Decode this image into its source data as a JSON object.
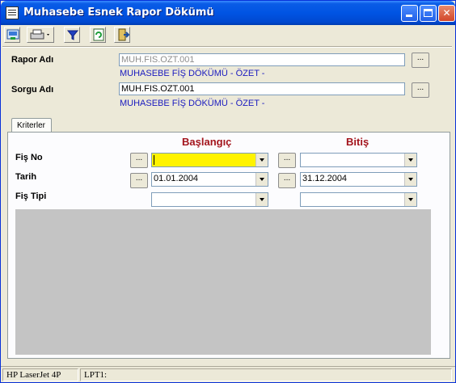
{
  "window": {
    "title": "Muhasebe Esnek Rapor Dökümü"
  },
  "form": {
    "rapor_label": "Rapor Adı",
    "rapor_value": "MUH.FIS.OZT.001",
    "rapor_desc": "MUHASEBE FİŞ DÖKÜMÜ - ÖZET -",
    "sorgu_label": "Sorgu Adı",
    "sorgu_value": "MUH.FIS.OZT.001",
    "sorgu_desc": "MUHASEBE FİŞ DÖKÜMÜ - ÖZET -",
    "lookup_button": "..."
  },
  "tabs": [
    {
      "label": "Kriterler"
    }
  ],
  "criteria": {
    "start_header": "Başlangıç",
    "end_header": "Bitiş",
    "rows": [
      {
        "label": "Fiş No",
        "start": "",
        "end": ""
      },
      {
        "label": "Tarih",
        "start": "01.01.2004",
        "end": "31.12.2004"
      },
      {
        "label": "Fiş Tipi",
        "start": "",
        "end": ""
      }
    ]
  },
  "statusbar": {
    "printer": "HP LaserJet 4P",
    "port": "LPT1:"
  },
  "colors": {
    "title_bar": "#0054e3",
    "header_red": "#a3141c",
    "desc_blue": "#1a1abf",
    "active_field": "#fff300"
  }
}
